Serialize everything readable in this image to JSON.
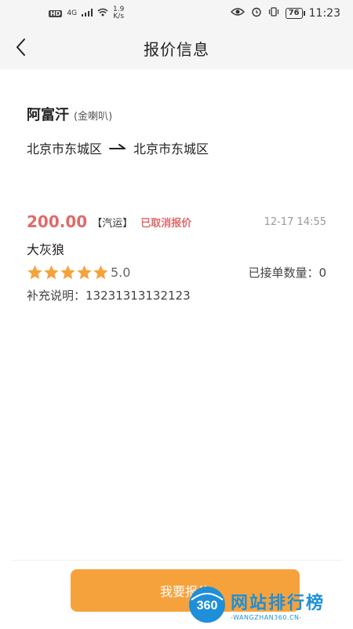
{
  "status_bar": {
    "hd": "HD",
    "network": "4G",
    "speed_value": "1.9",
    "speed_unit": "K/s",
    "battery": "76",
    "time": "11:23"
  },
  "nav": {
    "title": "报价信息"
  },
  "route": {
    "sender": "阿富汗",
    "sender_sub": "(金喇叭)",
    "from": "北京市东城区",
    "to": "北京市东城区"
  },
  "quote": {
    "price": "200.00",
    "mode": "【汽运】",
    "status": "已取消报价",
    "time": "12-17 14:55",
    "driver": "大灰狼",
    "rating": 5,
    "rating_text": "5.0",
    "orders_label": "已接单数量：0",
    "note_label": "补充说明：",
    "note_value": "13231313132123"
  },
  "actions": {
    "quote_button": "我要报价"
  },
  "watermark": {
    "logo_text": "360",
    "title": "网站排行榜",
    "subtitle": "-WANGZHAN360.CN-"
  },
  "colors": {
    "accent": "#f6a23c",
    "price": "#e06a6a",
    "star": "#f6a23c"
  }
}
